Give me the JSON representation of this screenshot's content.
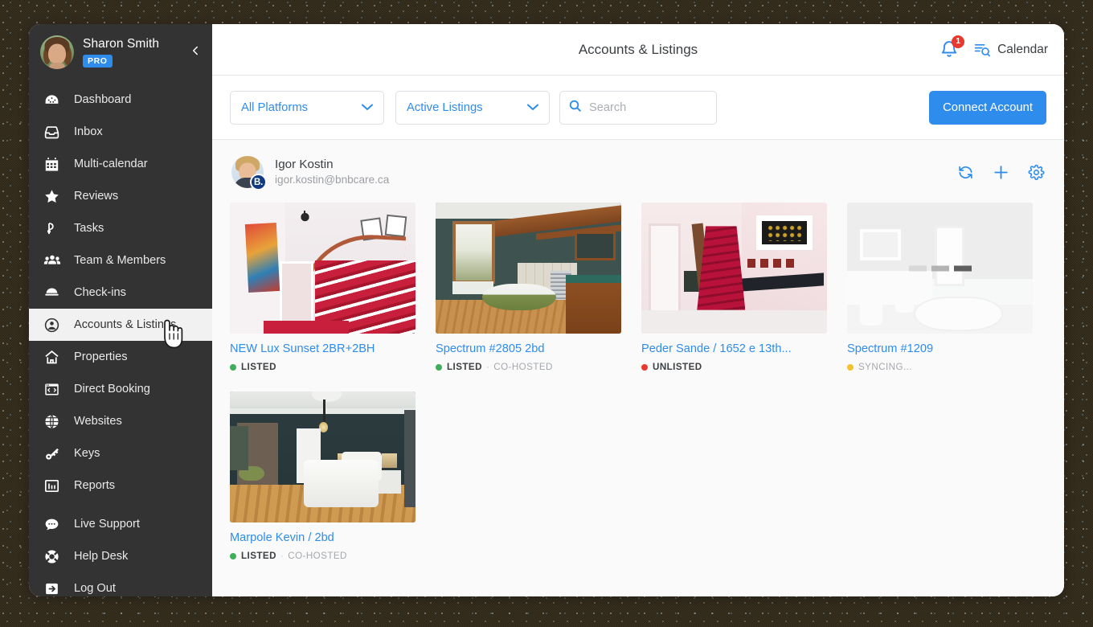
{
  "sidebar": {
    "user": {
      "name": "Sharon Smith",
      "badge": "PRO"
    },
    "collapse_label": "collapse-sidebar",
    "items": [
      {
        "label": "Dashboard",
        "icon": "dashboard-icon",
        "active": false
      },
      {
        "label": "Inbox",
        "icon": "inbox-icon",
        "active": false
      },
      {
        "label": "Multi-calendar",
        "icon": "calendar-icon",
        "active": false
      },
      {
        "label": "Reviews",
        "icon": "star-icon",
        "active": false
      },
      {
        "label": "Tasks",
        "icon": "tasks-icon",
        "active": false
      },
      {
        "label": "Team & Members",
        "icon": "team-icon",
        "active": false
      },
      {
        "label": "Check-ins",
        "icon": "bell-desk-icon",
        "active": false
      },
      {
        "label": "Accounts & Listings",
        "icon": "account-circle-icon",
        "active": true
      },
      {
        "label": "Properties",
        "icon": "home-icon",
        "active": false
      },
      {
        "label": "Direct Booking",
        "icon": "code-window-icon",
        "active": false
      },
      {
        "label": "Websites",
        "icon": "globe-icon",
        "active": false
      },
      {
        "label": "Keys",
        "icon": "key-icon",
        "active": false
      },
      {
        "label": "Reports",
        "icon": "bar-chart-icon",
        "active": false
      },
      {
        "label": "Live Support",
        "icon": "chat-bubble-icon",
        "active": false
      },
      {
        "label": "Help Desk",
        "icon": "lifebuoy-icon",
        "active": false
      },
      {
        "label": "Log Out",
        "icon": "logout-icon",
        "active": false
      }
    ]
  },
  "topbar": {
    "title": "Accounts & Listings",
    "notification_count": "1",
    "calendar_label": "Calendar"
  },
  "filters": {
    "platform_select": "All Platforms",
    "listing_select": "Active Listings",
    "search_placeholder": "Search",
    "search_value": "",
    "connect_button": "Connect Account"
  },
  "account": {
    "name": "Igor Kostin",
    "email": "igor.kostin@bnbcare.ca",
    "platform_badge": "B.",
    "actions": [
      "sync-icon",
      "add-icon",
      "settings-icon"
    ]
  },
  "listings": [
    {
      "title": "NEW Lux Sunset 2BR+2BH",
      "status": "LISTED",
      "status_color": "#3fae5a",
      "extra": "",
      "thumb": "staircase-red-carpet"
    },
    {
      "title": "Spectrum #2805 2bd",
      "status": "LISTED",
      "status_color": "#3fae5a",
      "extra": "CO-HOSTED",
      "thumb": "green-bathroom-clawfoot-tub"
    },
    {
      "title": "Peder Sande / 1652 e 13th...",
      "status": "UNLISTED",
      "status_color": "#e8392f",
      "extra": "",
      "thumb": "pink-hallway-red-stairs"
    },
    {
      "title": "Spectrum #1209",
      "status": "SYNCING...",
      "status_color": "#f2c230",
      "status_muted": true,
      "extra": "",
      "thumb": "faded-bathroom-loading"
    },
    {
      "title": "Marpole Kevin / 2bd",
      "status": "LISTED",
      "status_color": "#3fae5a",
      "extra": "CO-HOSTED",
      "thumb": "teal-bedroom-white-bed"
    }
  ],
  "colors": {
    "accent": "#2e8ced",
    "sidebar_bg": "#333333",
    "listed": "#3fae5a",
    "unlisted": "#e8392f",
    "syncing": "#f2c230",
    "badge_red": "#e8392f"
  }
}
